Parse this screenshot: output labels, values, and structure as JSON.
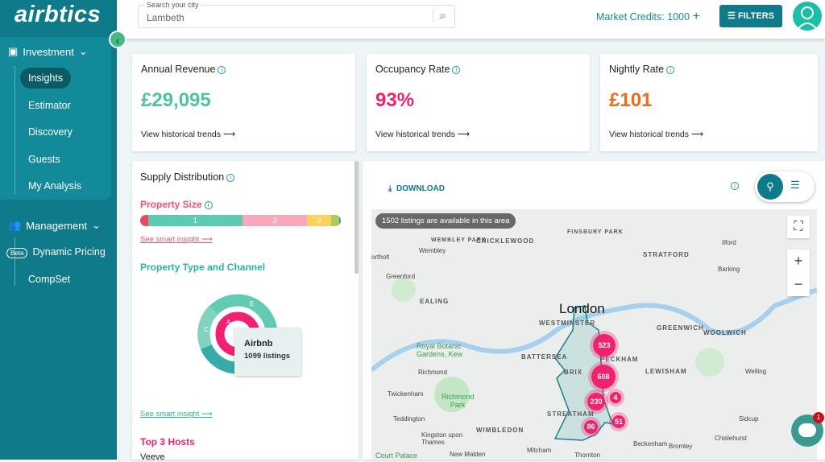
{
  "brand": {
    "logo": "airbtics"
  },
  "sidebar": {
    "investment": "Investment",
    "items": [
      {
        "label": "Insights",
        "active": true
      },
      {
        "label": "Estimator"
      },
      {
        "label": "Discovery"
      },
      {
        "label": "Guests"
      },
      {
        "label": "My Analysis"
      }
    ],
    "management": "Management",
    "mgmt_items": [
      {
        "label": "Dynamic Pricing",
        "badge": "Beta"
      },
      {
        "label": "CompSet"
      }
    ]
  },
  "header": {
    "search_label": "Search your city",
    "search_value": "Lambeth",
    "credits": "Market Credits: 1000",
    "filters": "FILTERS"
  },
  "kpis": [
    {
      "title": "Annual Revenue",
      "value": "£29,095",
      "color": "#4fc1a5",
      "link": "View historical trends"
    },
    {
      "title": "Occupancy Rate",
      "value": "93%",
      "color": "#f0216f",
      "link": "View historical trends"
    },
    {
      "title": "Nightly Rate",
      "value": "£101",
      "color": "#f26a1b",
      "link": "View historical trends"
    }
  ],
  "supply": {
    "title": "Supply Distribution",
    "size_title": "Property Size",
    "size_segments": [
      {
        "label": "",
        "share": 4,
        "color": "#e84c5c"
      },
      {
        "label": "1",
        "share": 48,
        "color": "#5ccbb2"
      },
      {
        "label": "2",
        "share": 33,
        "color": "#f8a8bd"
      },
      {
        "label": "3",
        "share": 12,
        "color": "#fad15a"
      },
      {
        "label": "",
        "share": 4,
        "color": "#a9cc60"
      },
      {
        "label": "",
        "share": 1,
        "color": "#1aa6b7"
      }
    ],
    "insight_link": "See smart insight",
    "type_title": "Property Type and Channel",
    "ring_labels": [
      "E",
      "C",
      "A"
    ],
    "tooltip_title": "Airbnb",
    "tooltip_value": "1099 listings",
    "hosts_title": "Top 3 Hosts",
    "hosts": [
      "Veeve"
    ]
  },
  "map": {
    "download": "DOWNLOAD",
    "listings_banner": "1502 listings are available in this area",
    "clusters": [
      "523",
      "608",
      "230",
      "4",
      "86",
      "51"
    ],
    "labels": {
      "london": "London",
      "westminster": "WESTMINSTER",
      "battersea": "BATTERSEA",
      "peckham": "PECKHAM",
      "lewisham": "LEWISHAM",
      "greenwich": "GREENWICH",
      "woolwich": "WOOLWICH",
      "stratford": "STRATFORD",
      "finsbury": "FINSBURY PARK",
      "cricklewood": "CRICKLEWOOD",
      "wembleypark": "WEMBLEY PARK",
      "wembley": "Wembley",
      "greenford": "Greenford",
      "ealing": "EALING",
      "richmond": "Richmond",
      "kew": "Royal Botanic Gardens, Kew",
      "twickenham": "Twickenham",
      "richmondpark": "Richmond Park",
      "teddington": "Teddington",
      "kingston": "Kingston upon Thames",
      "wimbledon": "WIMBLEDON",
      "streatham": "STREATHAM",
      "brixton": "BRIX",
      "mitcham": "Mitcham",
      "newmalden": "New Malden",
      "thornton": "Thornton",
      "beckenham": "Beckenham",
      "bromley": "Bromley",
      "chislehurst": "Chislehurst",
      "sidcup": "Sidcup",
      "welling": "Welling",
      "ilford": "Ilford",
      "barking": "Barking",
      "northolt": "ortholt",
      "hampton": "Court Palace"
    },
    "chat_badge": "1"
  }
}
